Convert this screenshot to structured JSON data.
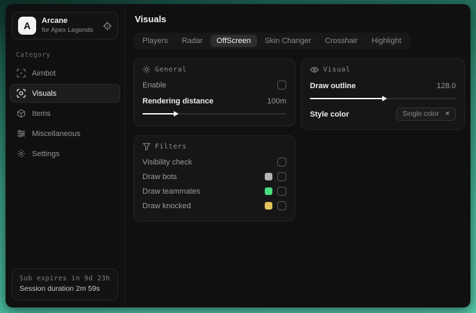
{
  "sidebar": {
    "logo_letter": "A",
    "app_name": "Arcane",
    "app_subtitle": "for Apex Legends",
    "category_label": "Category",
    "items": [
      {
        "label": "Aimbot",
        "icon": "crosshair-icon",
        "active": false
      },
      {
        "label": "Visuals",
        "icon": "scan-eye-icon",
        "active": true
      },
      {
        "label": "Items",
        "icon": "cube-icon",
        "active": false
      },
      {
        "label": "Miscellaneous",
        "icon": "sliders-icon",
        "active": false
      },
      {
        "label": "Settings",
        "icon": "gear-icon",
        "active": false
      }
    ],
    "footer": {
      "sub_expires": "Sub expires in 9d 23h",
      "session_duration": "Session duration 2m 59s"
    }
  },
  "main": {
    "title": "Visuals",
    "tabs": [
      {
        "label": "Players",
        "active": false
      },
      {
        "label": "Radar",
        "active": false
      },
      {
        "label": "OffScreen",
        "active": true
      },
      {
        "label": "Skin Changer",
        "active": false
      },
      {
        "label": "Crosshair",
        "active": false
      },
      {
        "label": "Highlight",
        "active": false
      }
    ],
    "general_card": {
      "title": "General",
      "enable_label": "Enable",
      "enable_checked": false,
      "distance_label": "Rendering distance",
      "distance_value": "100m",
      "distance_fill": "22%"
    },
    "visual_card": {
      "title": "Visual",
      "outline_label": "Draw outline",
      "outline_value": "128.0",
      "outline_fill": "50%",
      "style_label": "Style color",
      "style_value": "Single color",
      "style_clear": "×"
    },
    "filters_card": {
      "title": "Filters",
      "rows": [
        {
          "label": "Visibility check",
          "swatch": "",
          "checked": false
        },
        {
          "label": "Draw bots",
          "swatch": "#b5b5b5",
          "checked": false
        },
        {
          "label": "Draw teammates",
          "swatch": "#4ade80",
          "checked": false
        },
        {
          "label": "Draw knocked",
          "swatch": "#e2c25a",
          "checked": false
        }
      ]
    }
  },
  "colors": {
    "background_teal": "#4cbda1",
    "panel": "#101010",
    "card": "#161616",
    "accent_text": "#f2f2f2",
    "muted_text": "#9a9a9a",
    "swatch_gray": "#b5b5b5",
    "swatch_green": "#4ade80",
    "swatch_yellow": "#e2c25a"
  }
}
